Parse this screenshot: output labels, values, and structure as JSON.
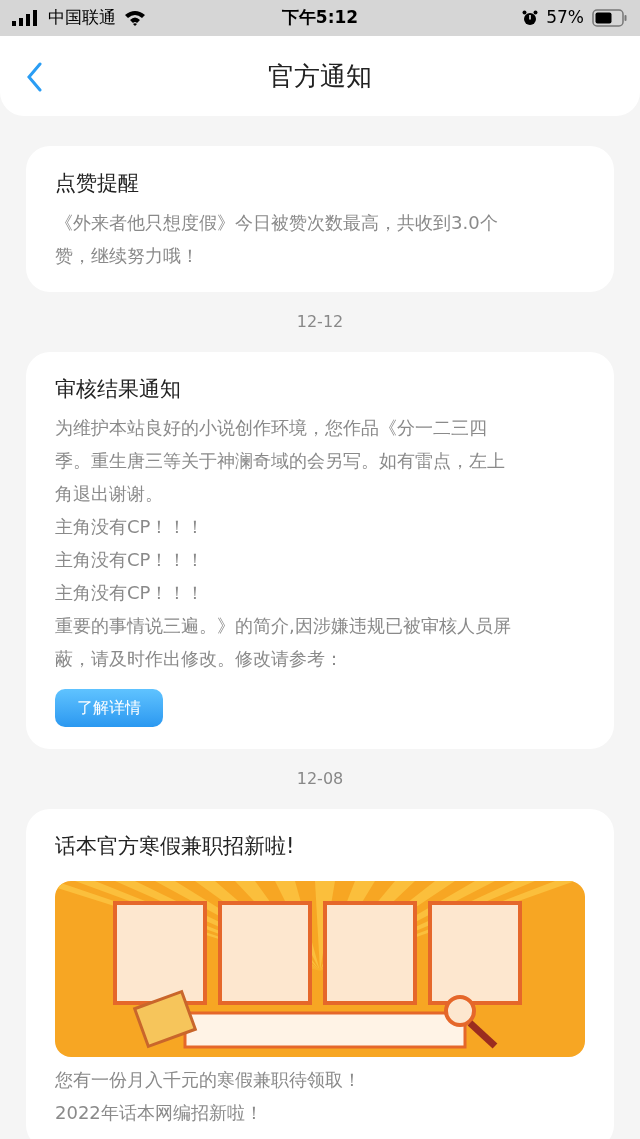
{
  "status_bar": {
    "carrier": "中国联通",
    "time": "下午5:12",
    "battery": "57%"
  },
  "header": {
    "title": "官方通知"
  },
  "notices": [
    {
      "kind": "text",
      "title": "点赞提醒",
      "lines": [
        "《外来者他只想度假》今日被赞次数最高，共收到3.0个",
        "赞，继续努力哦！"
      ]
    },
    {
      "kind": "text",
      "date": "12-12",
      "title": "审核结果通知",
      "lines": [
        "为维护本站良好的小说创作环境，您作品《分一二三四",
        "季。重生唐三等关于神澜奇域的会另写。如有雷点，左上",
        "角退出谢谢。",
        "主角没有CP！！！",
        "主角没有CP！！！",
        "主角没有CP！！！",
        "重要的事情说三遍。》的简介,因涉嫌违规已被审核人员屏",
        "蔽，请及时作出修改。修改请参考："
      ],
      "button": "了解详情"
    },
    {
      "kind": "banner",
      "date": "12-08",
      "title": "话本官方寒假兼职招新啦!",
      "lines": [
        "您有一份月入千元的寒假兼职待领取！",
        "2022年话本网编招新啦！"
      ]
    }
  ]
}
